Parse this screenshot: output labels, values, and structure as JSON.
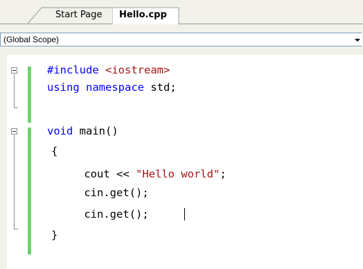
{
  "tabs": [
    {
      "label": "Start Page",
      "active": false
    },
    {
      "label": "Hello.cpp",
      "active": true
    }
  ],
  "scope": {
    "value": "(Global Scope)"
  },
  "code": {
    "line1": {
      "pre": "#include ",
      "inc": "<iostream>"
    },
    "line2": {
      "kw1": "using",
      "kw2": "namespace",
      "rest": " std;"
    },
    "line3": {
      "kw": "void",
      "rest": " main()"
    },
    "line4": {
      "text": "{"
    },
    "line5": {
      "pre": "    cout << ",
      "str": "\"Hello world\"",
      "post": ";"
    },
    "line6": {
      "text": "    cin.get();"
    },
    "line7": {
      "text": "    cin.get();"
    },
    "line8": {
      "text": "}"
    }
  },
  "colors": {
    "keyword": "#0000ff",
    "string": "#a31515",
    "changebar": "#6ed36e"
  }
}
